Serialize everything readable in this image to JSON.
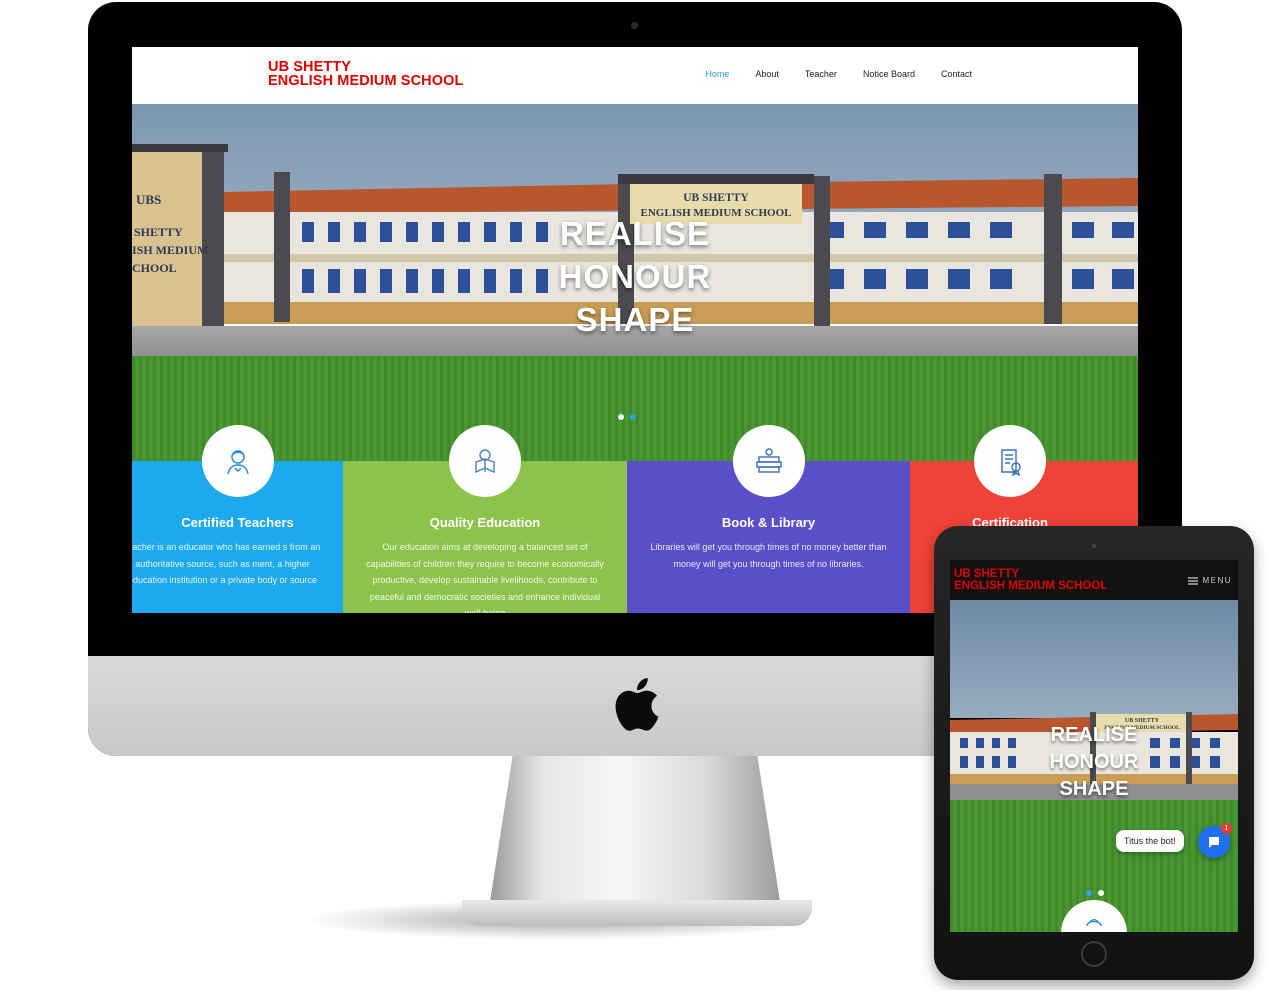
{
  "site": {
    "logo_line1": "UB SHETTY",
    "logo_line2": "ENGLISH MEDIUM SCHOOL",
    "nav": [
      {
        "label": "Home",
        "active": true
      },
      {
        "label": "About"
      },
      {
        "label": "Teacher"
      },
      {
        "label": "Notice Board"
      },
      {
        "label": "Contact"
      }
    ]
  },
  "hero": {
    "line1": "REALISE",
    "line2": "HONOUR",
    "line3": "SHAPE",
    "building_sign_line1": "UB SHETTY",
    "building_sign_line2": "ENGLISH MEDIUM SCHOOL",
    "wing_sign_line1": "UBS",
    "wing_sign_line2": "SHETTY",
    "wing_sign_line3": "ISH MEDIUM",
    "wing_sign_line4": "CHOOL",
    "slide_count": 2,
    "active_slide": 2
  },
  "features": [
    {
      "title": "Certified Teachers",
      "text": "teacher is an educator who has earned s from an authoritative source, such as ment, a higher education institution or a private body or source",
      "color": "#1ea9ec",
      "icon": "teacher-icon"
    },
    {
      "title": "Quality Education",
      "text": "Our education aims at developing a balanced set of capabilities of children they require to become economically productive, develop sustainable livelihoods, contribute to peaceful and democratic societies and enhance individual well-being",
      "color": "#8cc34b",
      "icon": "student-reading-icon"
    },
    {
      "title": "Book & Library",
      "text": "Libraries will get you through times of no money better than money will get you through times of no libraries.",
      "color": "#5a4fc8",
      "icon": "books-icon"
    },
    {
      "title": "Certification",
      "text": "",
      "color": "#ef4238",
      "icon": "certificate-icon"
    }
  ],
  "ipad": {
    "menu_label": "MENU",
    "chat_text": "Titus the bot!",
    "chat_badge": "1"
  },
  "colors": {
    "logo_red": "#e00000",
    "nav_active": "#2ea3f2"
  }
}
